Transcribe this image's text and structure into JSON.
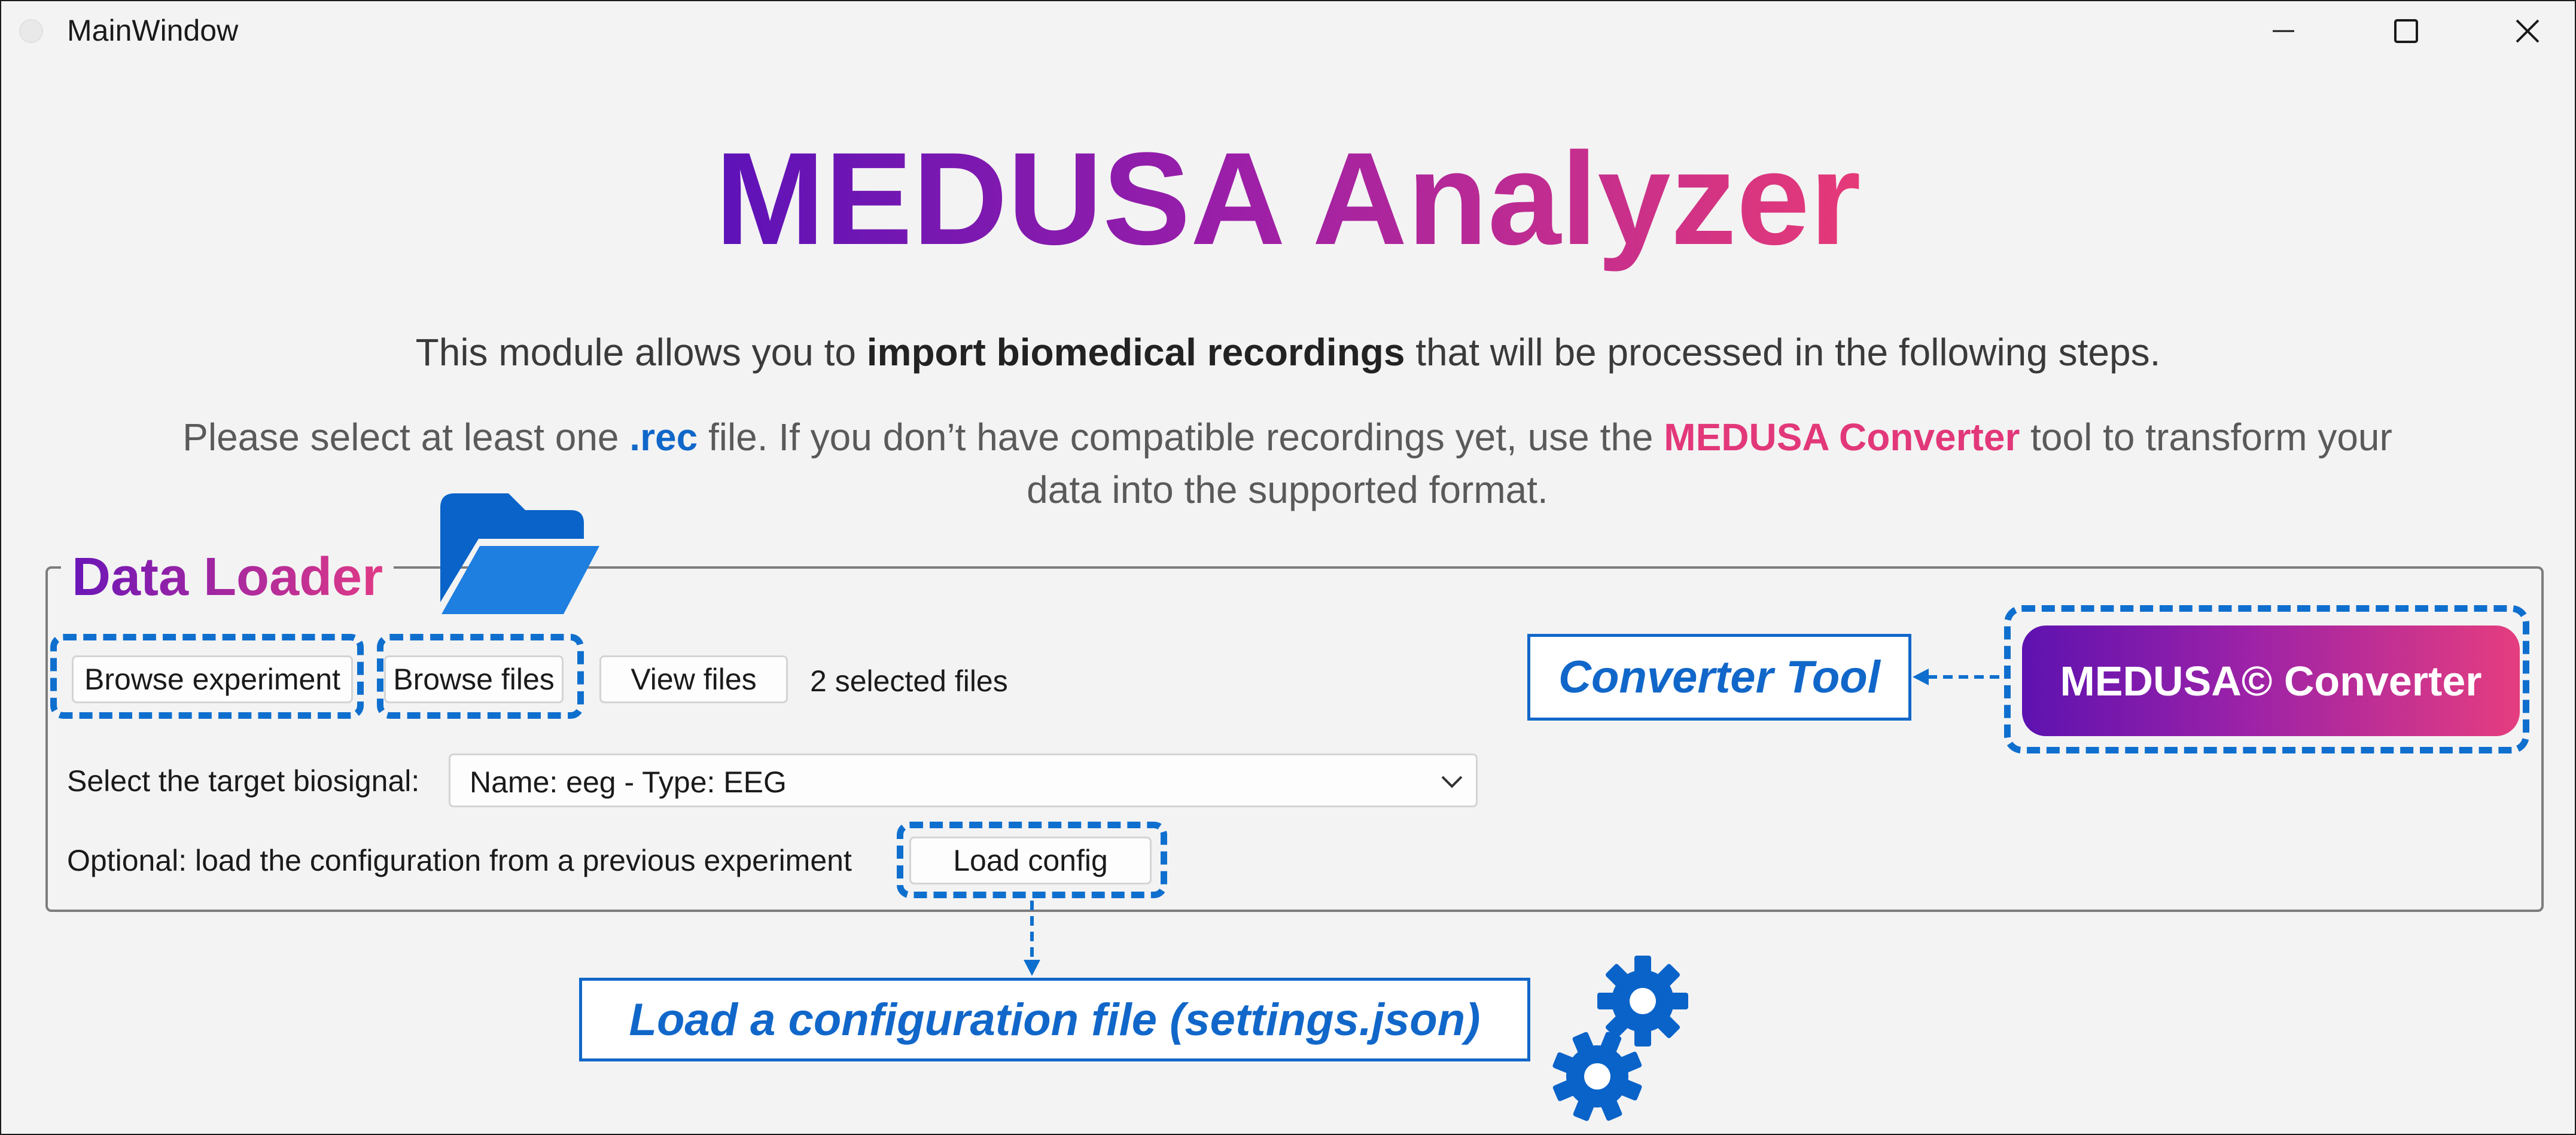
{
  "window": {
    "title": "MainWindow",
    "controls": {
      "minimize": "minimize-icon",
      "maximize": "maximize-icon",
      "close": "close-icon"
    }
  },
  "header": {
    "title": "MEDUSA Analyzer",
    "intro_pre": "This module allows you to ",
    "intro_bold": "import biomedical recordings",
    "intro_post": " that will be processed in the following steps.",
    "hint_pre": "Please select at least one ",
    "hint_rec": ".rec",
    "hint_mid": " file. If you don’t have compatible recordings yet, use the ",
    "hint_converter": "MEDUSA Converter",
    "hint_post": " tool to transform your data into the supported format."
  },
  "data_loader": {
    "title": "Data Loader",
    "browse_experiment": "Browse experiment",
    "browse_files": "Browse files",
    "view_files": "View files",
    "selected_files": "2 selected files",
    "target_label": "Select the target biosignal:",
    "target_value": "Name: eeg - Type: EEG",
    "optional_label": "Optional: load the configuration from a previous experiment",
    "load_config": "Load config"
  },
  "converter": {
    "button_label": "MEDUSA© Converter",
    "callout": "Converter Tool"
  },
  "annotations": {
    "load_callout": "Load a configuration file (settings.json)"
  },
  "colors": {
    "accent_blue": "#0f6fce",
    "gradient_start": "#5d12b8",
    "gradient_end": "#e63a78",
    "converter_pink": "#e2387a"
  },
  "icons": [
    "folder-icon",
    "gear-icon",
    "chevron-down-icon"
  ]
}
